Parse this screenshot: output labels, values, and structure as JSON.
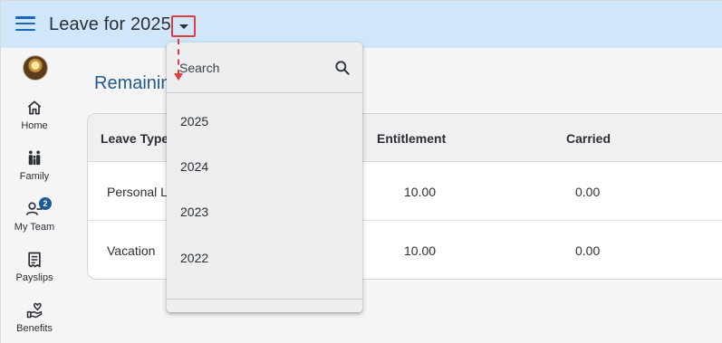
{
  "appbar": {
    "title": "Leave for 2025"
  },
  "rail": {
    "items": [
      {
        "label": "Home",
        "icon": "home-icon"
      },
      {
        "label": "Family",
        "icon": "family-icon"
      },
      {
        "label": "My Team",
        "icon": "team-icon",
        "badge": "2"
      },
      {
        "label": "Payslips",
        "icon": "payslip-icon"
      },
      {
        "label": "Benefits",
        "icon": "benefits-icon"
      }
    ]
  },
  "main": {
    "section_title": "Remaining Leave",
    "table": {
      "headers": [
        "Leave Type",
        "Entitlement",
        "Carried"
      ],
      "rows": [
        {
          "type": "Personal Leave",
          "entitlement": "10.00",
          "carried": "0.00"
        },
        {
          "type": "Vacation",
          "entitlement": "10.00",
          "carried": "0.00"
        }
      ]
    }
  },
  "dropdown": {
    "search_placeholder": "Search",
    "options": [
      "2025",
      "2024",
      "2023",
      "2022"
    ]
  },
  "colors": {
    "appbar_bg": "#cfe6fb",
    "accent": "#1a66c2",
    "highlight": "#e23b3b",
    "badge": "#1a5a9a"
  }
}
